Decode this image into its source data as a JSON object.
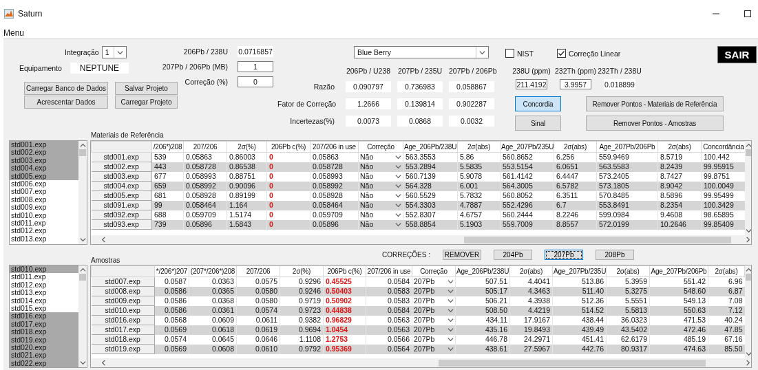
{
  "window": {
    "title": "Saturn"
  },
  "menu": [
    {
      "label": "Menu"
    }
  ],
  "integration": {
    "label": "Integração",
    "value": "1"
  },
  "equipment": {
    "label": "Equipamento",
    "value": "NEPTUNE"
  },
  "project_buttons": [
    "Carregar Banco de Dados",
    "Salvar Projeto",
    "Acrescentar Dados",
    "Carregar Projeto"
  ],
  "mass_bias": [
    {
      "label": "206Pb / 238U",
      "value": "0.0716857",
      "editable": false
    },
    {
      "label": "207Pb / 206Pb (MB)",
      "value": "1",
      "editable": true
    },
    {
      "label": "Correção (%)",
      "value": "0",
      "editable": true
    }
  ],
  "reference_material": {
    "value": "Blue Berry"
  },
  "ratios": {
    "columns": [
      "206Pb / U238",
      "207Pb / 235U",
      "207Pb / 206Pb"
    ],
    "rows": [
      {
        "label": "Razão",
        "values": [
          "0.090797",
          "0.736983",
          "0.058867"
        ]
      },
      {
        "label": "Fator de Correção",
        "values": [
          "1.2666",
          "0.139814",
          "0.902287"
        ]
      },
      {
        "label": "Incertezas(%)",
        "values": [
          "0.0073",
          "0.0868",
          "0.0032"
        ]
      }
    ]
  },
  "options": [
    {
      "label": "NIST",
      "checked": false
    },
    {
      "label": "Correção Linear",
      "checked": true
    }
  ],
  "exit_button": "SAIR",
  "concentrations": [
    {
      "label": "238U (ppm)",
      "value": "211.4192",
      "editable": true
    },
    {
      "label": "232Th (ppm)",
      "value": "3.9957",
      "editable": true
    },
    {
      "label": "232Th / 238U",
      "value": "0.018899",
      "editable": false
    }
  ],
  "plot_buttons": [
    {
      "label": "Concordia",
      "selected": true
    },
    {
      "label": "Sinal",
      "selected": false
    }
  ],
  "remove_buttons": [
    "Remover Pontos - Materiais de Referência",
    "Remover Pontos - Amostras"
  ],
  "reference": {
    "title": "Materiais de Referência",
    "files": [
      {
        "name": "std001.exp",
        "selected": true
      },
      {
        "name": "std002.exp",
        "selected": true
      },
      {
        "name": "std003.exp",
        "selected": true
      },
      {
        "name": "std004.exp",
        "selected": true
      },
      {
        "name": "std005.exp",
        "selected": true
      },
      {
        "name": "std006.exp",
        "selected": false
      },
      {
        "name": "std007.exp",
        "selected": false
      },
      {
        "name": "std008.exp",
        "selected": false
      },
      {
        "name": "std009.exp",
        "selected": false
      },
      {
        "name": "std010.exp",
        "selected": false
      },
      {
        "name": "std011.exp",
        "selected": false
      },
      {
        "name": "std012.exp",
        "selected": false
      },
      {
        "name": "std013.exp",
        "selected": false
      }
    ],
    "table": {
      "columns": [
        {
          "label": "/206*)208",
          "kind": "value"
        },
        {
          "label": "207/206",
          "kind": "value"
        },
        {
          "label": "2σ(%)",
          "kind": "value"
        },
        {
          "label": "206Pb c(%)",
          "kind": "flag"
        },
        {
          "label": "207/206 in use",
          "kind": "value"
        },
        {
          "label": "Correção",
          "kind": "choice"
        },
        {
          "label": "Age_206Pb/238U",
          "kind": "value"
        },
        {
          "label": "2σ(abs)",
          "kind": "value"
        },
        {
          "label": "Age_207Pb/235U",
          "kind": "value"
        },
        {
          "label": "2σ(abs)",
          "kind": "value"
        },
        {
          "label": "Age_207Pb/206Pb",
          "kind": "value"
        },
        {
          "label": "2σ(abs)",
          "kind": "value"
        },
        {
          "label": "Concordância",
          "kind": "value"
        }
      ],
      "rows": [
        {
          "name": "std001.exp",
          "cells": [
            "539",
            "0.05863",
            "0.86003",
            "0",
            "0.05863",
            "Não",
            "563.3553",
            "5.86",
            "560.8652",
            "6.256",
            "559.9469",
            "8.5719",
            "100.442"
          ]
        },
        {
          "name": "std002.exp",
          "cells": [
            "443",
            "0.058728",
            "0.86538",
            "0",
            "0.058728",
            "Não",
            "553.2894",
            "5.5835",
            "553.5154",
            "6.0651",
            "563.5583",
            "8.2439",
            "99.95915"
          ]
        },
        {
          "name": "std003.exp",
          "cells": [
            "677",
            "0.058993",
            "0.88751",
            "0",
            "0.058993",
            "Não",
            "560.7139",
            "5.9078",
            "561.4142",
            "6.4447",
            "573.2405",
            "8.7427",
            "99.8751"
          ]
        },
        {
          "name": "std004.exp",
          "cells": [
            "659",
            "0.058992",
            "0.90096",
            "0",
            "0.058992",
            "Não",
            "564.328",
            "6.001",
            "564.3005",
            "6.5782",
            "573.1805",
            "8.9042",
            "100.0049"
          ]
        },
        {
          "name": "std005.exp",
          "cells": [
            "681",
            "0.058928",
            "0.89199",
            "0",
            "0.058928",
            "Não",
            "560.5529",
            "5.7832",
            "560.8052",
            "6.3511",
            "570.8485",
            "8.5896",
            "99.95499"
          ]
        },
        {
          "name": "std091.exp",
          "cells": [
            "99",
            "0.058464",
            "1.164",
            "0",
            "0.058464",
            "Não",
            "554.3303",
            "4.7887",
            "552.4296",
            "6.7",
            "553.8491",
            "8.2354",
            "100.3429"
          ]
        },
        {
          "name": "std092.exp",
          "cells": [
            "688",
            "0.059709",
            "1.5174",
            "0",
            "0.059709",
            "Não",
            "552.8307",
            "4.6757",
            "560.2444",
            "8.2246",
            "599.0984",
            "9.4608",
            "98.65895"
          ]
        },
        {
          "name": "std093.exp",
          "cells": [
            "739",
            "0.05896",
            "1.5843",
            "0",
            "0.05896",
            "Não",
            "558.8854",
            "5.1903",
            "559.7009",
            "8.8557",
            "572.0199",
            "10.2646",
            "99.85409"
          ]
        }
      ]
    }
  },
  "corrections": {
    "label": "CORREÇÕES :",
    "buttons": [
      {
        "label": "REMOVER",
        "selected": false
      },
      {
        "label": "204Pb",
        "selected": false
      },
      {
        "label": "207Pb",
        "selected": true
      },
      {
        "label": "208Pb",
        "selected": false
      }
    ]
  },
  "samples": {
    "title": "Amostras",
    "files": [
      {
        "name": "std010.exp",
        "selected": true
      },
      {
        "name": "std011.exp",
        "selected": false
      },
      {
        "name": "std012.exp",
        "selected": false
      },
      {
        "name": "std013.exp",
        "selected": false
      },
      {
        "name": "std014.exp",
        "selected": false
      },
      {
        "name": "std015.exp",
        "selected": false
      },
      {
        "name": "std016.exp",
        "selected": true
      },
      {
        "name": "std017.exp",
        "selected": true
      },
      {
        "name": "std018.exp",
        "selected": true
      },
      {
        "name": "std019.exp",
        "selected": true
      },
      {
        "name": "std020.exp",
        "selected": true
      },
      {
        "name": "std021.exp",
        "selected": true
      },
      {
        "name": "std022.exp",
        "selected": true
      }
    ],
    "table": {
      "columns": [
        {
          "label": "*/206*)207",
          "kind": "value"
        },
        {
          "label": "(207*/206*)208",
          "kind": "value"
        },
        {
          "label": "207/206",
          "kind": "value"
        },
        {
          "label": "2σ(%)",
          "kind": "value"
        },
        {
          "label": "206Pb c(%)",
          "kind": "flag"
        },
        {
          "label": "207/206 in use",
          "kind": "value"
        },
        {
          "label": "Correção",
          "kind": "choice"
        },
        {
          "label": "Age_206Pb/238U",
          "kind": "value"
        },
        {
          "label": "2σ(abs)",
          "kind": "value"
        },
        {
          "label": "Age_207Pb/235U",
          "kind": "value"
        },
        {
          "label": "2σ(abs)",
          "kind": "value"
        },
        {
          "label": "Age_207Pb/206Pb",
          "kind": "value"
        },
        {
          "label": "2σ(abs)",
          "kind": "value"
        }
      ],
      "rows": [
        {
          "name": "std007.exp",
          "cells": [
            "0.0587",
            "0.0363",
            "0.0575",
            "0.9296",
            "0.45525",
            "0.0584",
            "207Pb",
            "507.51",
            "4.4041",
            "513.86",
            "5.3959",
            "551.42",
            "6.96"
          ]
        },
        {
          "name": "std008.exp",
          "cells": [
            "0.0586",
            "0.0365",
            "0.0580",
            "0.9246",
            "0.50403",
            "0.0583",
            "207Pb",
            "505.17",
            "4.3463",
            "511.40",
            "5.3275",
            "548.60",
            "6.87"
          ]
        },
        {
          "name": "std009.exp",
          "cells": [
            "0.0586",
            "0.0368",
            "0.0580",
            "0.9719",
            "0.50902",
            "0.0583",
            "207Pb",
            "506.21",
            "4.3938",
            "512.36",
            "5.5551",
            "549.13",
            "7.08"
          ]
        },
        {
          "name": "std010.exp",
          "cells": [
            "0.0586",
            "0.0361",
            "0.0574",
            "0.9723",
            "0.44838",
            "0.0584",
            "207Pb",
            "508.50",
            "4.4219",
            "514.52",
            "5.5813",
            "550.63",
            "7.12"
          ]
        },
        {
          "name": "std016.exp",
          "cells": [
            "0.0568",
            "0.0609",
            "0.0611",
            "0.9382",
            "0.96829",
            "0.0563",
            "207Pb",
            "434.11",
            "17.9167",
            "438.44",
            "36.0323",
            "471.53",
            "40.24"
          ]
        },
        {
          "name": "std017.exp",
          "cells": [
            "0.0569",
            "0.0618",
            "0.0619",
            "0.9694",
            "1.0454",
            "0.0563",
            "207Pb",
            "435.16",
            "19.8493",
            "439.49",
            "43.5402",
            "472.46",
            "47.85"
          ]
        },
        {
          "name": "std018.exp",
          "cells": [
            "0.0574",
            "0.0645",
            "0.0646",
            "1.1108",
            "1.2753",
            "0.0566",
            "207Pb",
            "446.78",
            "24.2971",
            "451.41",
            "62.6179",
            "485.19",
            "67.16"
          ]
        },
        {
          "name": "std019.exp",
          "cells": [
            "0.0569",
            "0.0608",
            "0.0610",
            "0.9792",
            "0.95369",
            "0.0564",
            "207Pb",
            "438.61",
            "27.5967",
            "442.76",
            "80.9317",
            "474.63",
            "85.50"
          ]
        }
      ]
    }
  }
}
